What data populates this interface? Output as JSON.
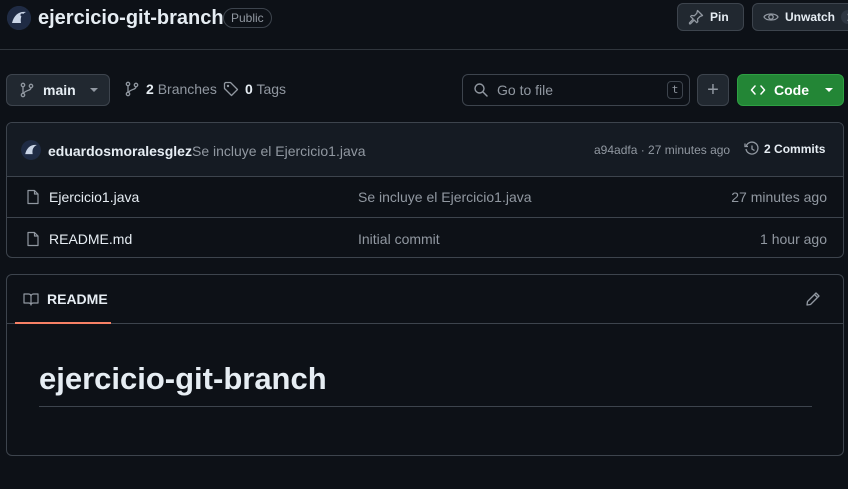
{
  "repo": {
    "name": "ejercicio-git-branch",
    "visibility": "Public"
  },
  "header_actions": {
    "pin_label": "Pin",
    "unwatch_label": "Unwatch",
    "unwatch_count": "1"
  },
  "toolbar": {
    "branch": "main",
    "branches_count": "2",
    "branches_label": "Branches",
    "tags_count": "0",
    "tags_label": "Tags",
    "search_placeholder": "Go to file",
    "search_shortcut": "t",
    "add_label": "+",
    "code_label": "Code"
  },
  "latest_commit": {
    "author": "eduardosmoralesglez",
    "message": "Se incluye el Ejercicio1.java",
    "hash_time": "a94adfa · 27 minutes ago",
    "commits_count": "2",
    "commits_label": "Commits"
  },
  "files": [
    {
      "name": "Ejercicio1.java",
      "message": "Se incluye el Ejercicio1.java",
      "time": "27 minutes ago"
    },
    {
      "name": "README.md",
      "message": "Initial commit",
      "time": "1 hour ago"
    }
  ],
  "readme": {
    "tab_label": "README",
    "title": "ejercicio-git-branch"
  },
  "colors": {
    "background": "#0d1117",
    "accent_green": "#238636",
    "tab_underline": "#f78166"
  }
}
